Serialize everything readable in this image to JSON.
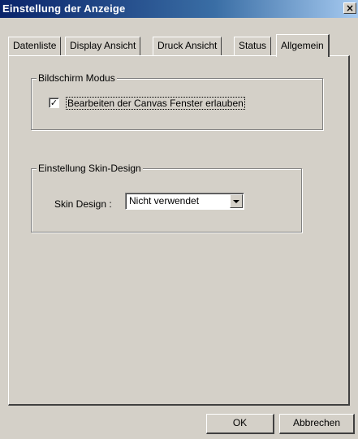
{
  "window": {
    "title": "Einstellung der Anzeige",
    "close_glyph": "×"
  },
  "tabs": [
    {
      "label": "Datenliste",
      "active": false
    },
    {
      "label": "Display Ansicht",
      "active": false
    },
    {
      "label": "Druck Ansicht",
      "active": false
    },
    {
      "label": "Status",
      "active": false
    },
    {
      "label": "Allgemein",
      "active": true
    }
  ],
  "screen_mode": {
    "legend": "Bildschirm Modus",
    "checkbox_label": "Bearbeiten der Canvas Fenster erlauben",
    "checked": true,
    "check_glyph": "✓"
  },
  "skin": {
    "legend": "Einstellung Skin-Design",
    "label": "Skin Design :",
    "selected": "Nicht verwendet"
  },
  "buttons": {
    "ok": "OK",
    "cancel": "Abbrechen"
  }
}
